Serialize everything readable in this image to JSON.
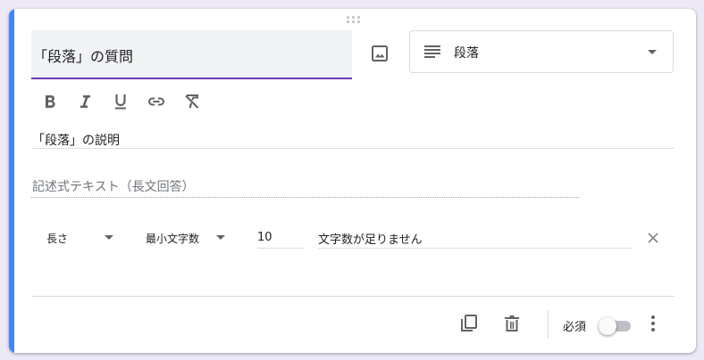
{
  "question": {
    "title": "「段落」の質問",
    "description": "「段落」の説明",
    "answer_placeholder": "記述式テキスト（長文回答）"
  },
  "type_select": {
    "selected": "段落",
    "icon": "lines-icon"
  },
  "formatting": {
    "buttons": [
      "bold-icon",
      "italic-icon",
      "underline-icon",
      "link-icon",
      "clear-format-icon"
    ]
  },
  "validation": {
    "type": "長さ",
    "operator": "最小文字数",
    "value": "10",
    "error_text": "文字数が足りません"
  },
  "footer": {
    "required_label": "必須",
    "required_on": false
  },
  "colors": {
    "accent": "#4285f4",
    "title_underline": "#673ab7",
    "icon": "#5f6368"
  }
}
